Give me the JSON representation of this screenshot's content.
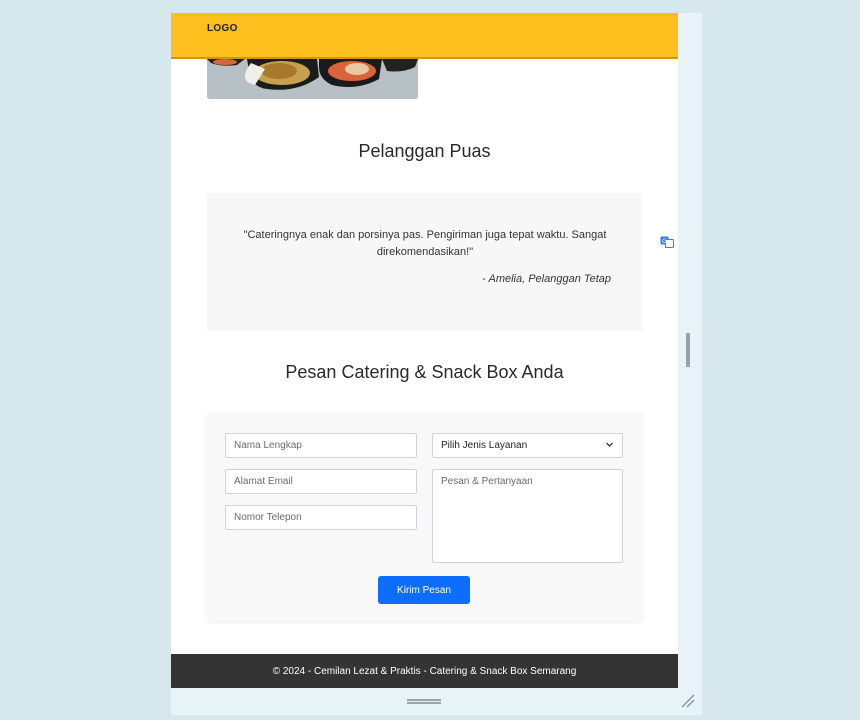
{
  "header": {
    "logo": "LOGO"
  },
  "testimonials": {
    "title": "Pelanggan Puas",
    "quote": "\"Cateringnya enak dan porsinya pas. Pengiriman juga tepat waktu. Sangat direkomendasikan!\"",
    "author": "- Amelia, Pelanggan Tetap"
  },
  "order": {
    "title": "Pesan Catering & Snack Box Anda",
    "name_placeholder": "Nama Lengkap",
    "email_placeholder": "Alamat Email",
    "phone_placeholder": "Nomor Telepon",
    "service_select": "Pilih Jenis Layanan",
    "message_placeholder": "Pesan & Pertanyaan",
    "submit_label": "Kirim Pesan"
  },
  "footer": {
    "text": "© 2024 - Cemilan Lezat & Praktis - Catering & Snack Box Semarang"
  },
  "colors": {
    "header": "#fdbf1d",
    "button": "#0d6efd",
    "footer": "#343434"
  },
  "icons": [
    "translate-icon",
    "chevron-down-icon",
    "resize-handle-icon"
  ]
}
